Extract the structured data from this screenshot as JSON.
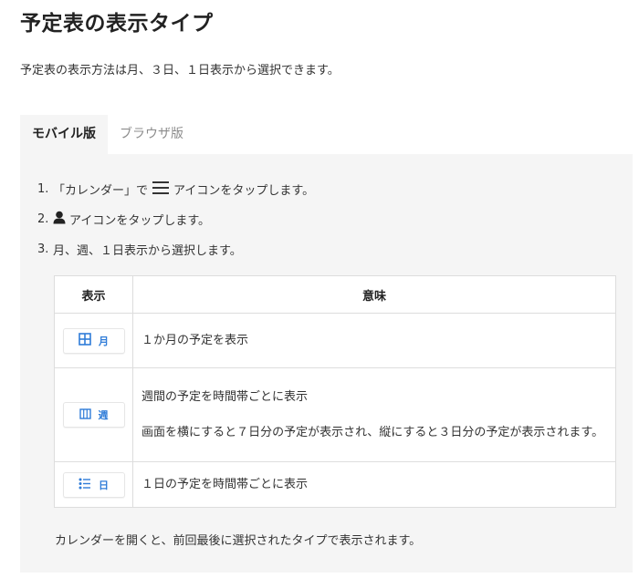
{
  "page": {
    "title": "予定表の表示タイプ",
    "intro": "予定表の表示方法は月、３日、１日表示から選択できます。"
  },
  "tabs": [
    {
      "label": "モバイル版",
      "active": true
    },
    {
      "label": "ブラウザ版",
      "active": false
    }
  ],
  "steps": [
    {
      "num": "1.",
      "before": "「カレンダー」で",
      "icon": "menu-icon",
      "after": "アイコンをタップします。"
    },
    {
      "num": "2.",
      "before": "",
      "icon": "user-icon",
      "after": "アイコンをタップします。"
    },
    {
      "num": "3.",
      "before": "",
      "icon": "",
      "after": "月、週、１日表示から選択します。"
    }
  ],
  "table": {
    "headers": [
      "表示",
      "意味"
    ],
    "rows": [
      {
        "mode": "月",
        "icon": "month-grid-icon",
        "lines": [
          "１か月の予定を表示"
        ]
      },
      {
        "mode": "週",
        "icon": "week-columns-icon",
        "lines": [
          "週間の予定を時間帯ごとに表示",
          "画面を横にすると７日分の予定が表示され、縦にすると３日分の予定が表示されます。"
        ]
      },
      {
        "mode": "日",
        "icon": "day-list-icon",
        "lines": [
          "１日の予定を時間帯ごとに表示"
        ]
      }
    ]
  },
  "closing": "カレンダーを開くと、前回最後に選択されたタイプで表示されます。",
  "colors": {
    "accent": "#2f7cd8",
    "panel_bg": "#f5f5f5",
    "border": "#dddddd"
  }
}
